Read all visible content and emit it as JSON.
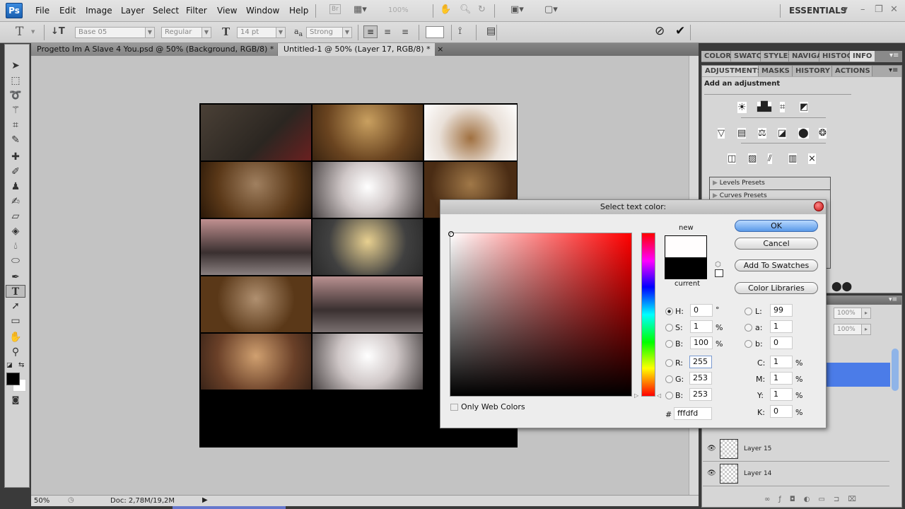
{
  "app": {
    "name": "Photoshop",
    "logo": "Ps"
  },
  "menu": [
    "File",
    "Edit",
    "Image",
    "Layer",
    "Select",
    "Filter",
    "View",
    "Window",
    "Help"
  ],
  "appbar": {
    "zoom": "100%",
    "workspace": "ESSENTIALS",
    "bridge_label": "Br"
  },
  "options": {
    "tool_glyph": "T",
    "font_family": "Base 05",
    "font_style": "Regular",
    "font_size": "14 pt",
    "aa_label": "a a",
    "antialias": "Strong"
  },
  "tabs": [
    {
      "label": "Progetto Im A Slave 4 You.psd @ 50% (Background, RGB/8) *",
      "active": false
    },
    {
      "label": "Untitled-1 @ 50% (Layer 17, RGB/8) *",
      "active": true
    }
  ],
  "tab_close": "×",
  "panels": {
    "top_tabs": [
      "COLOR",
      "SWATC",
      "STYLES",
      "NAVIGA",
      "HISTOG",
      "INFO"
    ],
    "adj_tabs": [
      "ADJUSTMENTS",
      "MASKS",
      "HISTORY",
      "ACTIONS"
    ],
    "adj_heading": "Add an adjustment",
    "presets": [
      "Levels Presets",
      "Curves Presets"
    ],
    "opacity": "100%",
    "fill": "100%",
    "layers": [
      {
        "name": "Layer 15"
      },
      {
        "name": "Layer 14"
      }
    ]
  },
  "status": {
    "zoom": "50%",
    "doc": "Doc: 2,78M/19,2M"
  },
  "dialog": {
    "title": "Select text color:",
    "new_label": "new",
    "current_label": "current",
    "new_color": "#fffdfd",
    "current_color": "#000000",
    "buttons": {
      "ok": "OK",
      "cancel": "Cancel",
      "add_swatches": "Add To Swatches",
      "libraries": "Color Libraries"
    },
    "only_web": "Only Web Colors",
    "hsb": {
      "H": "0",
      "S": "1",
      "B": "100"
    },
    "units": {
      "deg": "°",
      "pct": "%"
    },
    "rgb": {
      "R": "255",
      "G": "253",
      "B": "253"
    },
    "lab": {
      "L": "99",
      "a": "1",
      "b": "0"
    },
    "cmyk": {
      "C": "1",
      "M": "1",
      "Y": "1",
      "K": "0"
    },
    "hex": "fffdfd",
    "labels": {
      "H": "H:",
      "S": "S:",
      "Bh": "B:",
      "R": "R:",
      "G": "G:",
      "Br": "B:",
      "L": "L:",
      "a": "a:",
      "b": "b:",
      "C": "C:",
      "M": "M:",
      "Y": "Y:",
      "K": "K:",
      "hash": "#"
    }
  }
}
